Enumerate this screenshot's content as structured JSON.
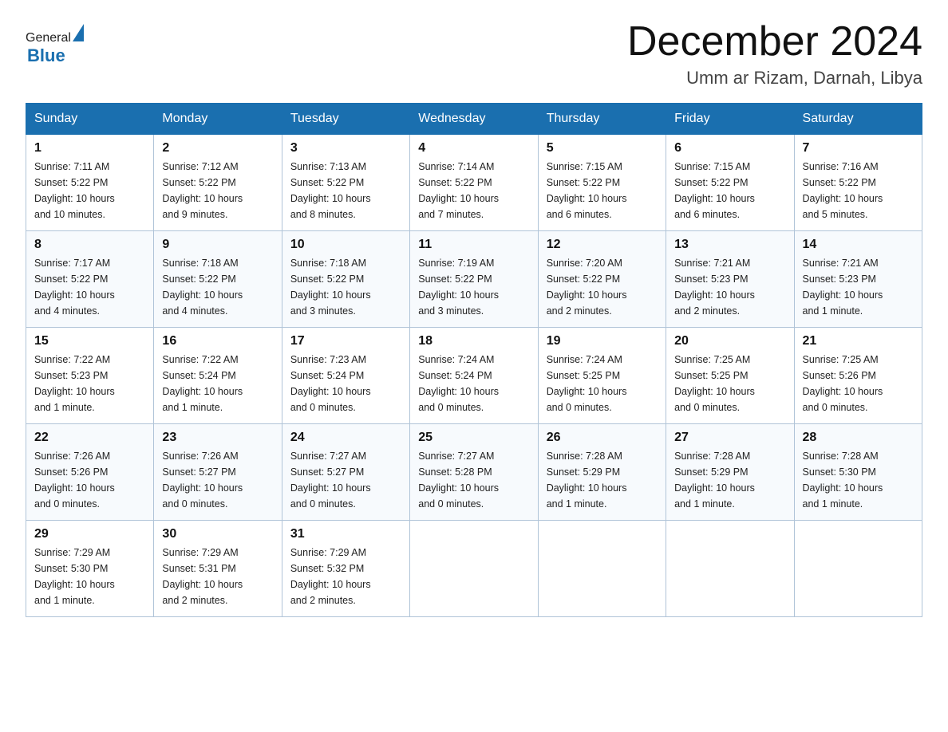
{
  "header": {
    "logo_general": "General",
    "logo_blue": "Blue",
    "month_title": "December 2024",
    "location": "Umm ar Rizam, Darnah, Libya"
  },
  "weekdays": [
    "Sunday",
    "Monday",
    "Tuesday",
    "Wednesday",
    "Thursday",
    "Friday",
    "Saturday"
  ],
  "weeks": [
    [
      {
        "day": 1,
        "sunrise": "7:11 AM",
        "sunset": "5:22 PM",
        "daylight": "10 hours and 10 minutes."
      },
      {
        "day": 2,
        "sunrise": "7:12 AM",
        "sunset": "5:22 PM",
        "daylight": "10 hours and 9 minutes."
      },
      {
        "day": 3,
        "sunrise": "7:13 AM",
        "sunset": "5:22 PM",
        "daylight": "10 hours and 8 minutes."
      },
      {
        "day": 4,
        "sunrise": "7:14 AM",
        "sunset": "5:22 PM",
        "daylight": "10 hours and 7 minutes."
      },
      {
        "day": 5,
        "sunrise": "7:15 AM",
        "sunset": "5:22 PM",
        "daylight": "10 hours and 6 minutes."
      },
      {
        "day": 6,
        "sunrise": "7:15 AM",
        "sunset": "5:22 PM",
        "daylight": "10 hours and 6 minutes."
      },
      {
        "day": 7,
        "sunrise": "7:16 AM",
        "sunset": "5:22 PM",
        "daylight": "10 hours and 5 minutes."
      }
    ],
    [
      {
        "day": 8,
        "sunrise": "7:17 AM",
        "sunset": "5:22 PM",
        "daylight": "10 hours and 4 minutes."
      },
      {
        "day": 9,
        "sunrise": "7:18 AM",
        "sunset": "5:22 PM",
        "daylight": "10 hours and 4 minutes."
      },
      {
        "day": 10,
        "sunrise": "7:18 AM",
        "sunset": "5:22 PM",
        "daylight": "10 hours and 3 minutes."
      },
      {
        "day": 11,
        "sunrise": "7:19 AM",
        "sunset": "5:22 PM",
        "daylight": "10 hours and 3 minutes."
      },
      {
        "day": 12,
        "sunrise": "7:20 AM",
        "sunset": "5:22 PM",
        "daylight": "10 hours and 2 minutes."
      },
      {
        "day": 13,
        "sunrise": "7:21 AM",
        "sunset": "5:23 PM",
        "daylight": "10 hours and 2 minutes."
      },
      {
        "day": 14,
        "sunrise": "7:21 AM",
        "sunset": "5:23 PM",
        "daylight": "10 hours and 1 minute."
      }
    ],
    [
      {
        "day": 15,
        "sunrise": "7:22 AM",
        "sunset": "5:23 PM",
        "daylight": "10 hours and 1 minute."
      },
      {
        "day": 16,
        "sunrise": "7:22 AM",
        "sunset": "5:24 PM",
        "daylight": "10 hours and 1 minute."
      },
      {
        "day": 17,
        "sunrise": "7:23 AM",
        "sunset": "5:24 PM",
        "daylight": "10 hours and 0 minutes."
      },
      {
        "day": 18,
        "sunrise": "7:24 AM",
        "sunset": "5:24 PM",
        "daylight": "10 hours and 0 minutes."
      },
      {
        "day": 19,
        "sunrise": "7:24 AM",
        "sunset": "5:25 PM",
        "daylight": "10 hours and 0 minutes."
      },
      {
        "day": 20,
        "sunrise": "7:25 AM",
        "sunset": "5:25 PM",
        "daylight": "10 hours and 0 minutes."
      },
      {
        "day": 21,
        "sunrise": "7:25 AM",
        "sunset": "5:26 PM",
        "daylight": "10 hours and 0 minutes."
      }
    ],
    [
      {
        "day": 22,
        "sunrise": "7:26 AM",
        "sunset": "5:26 PM",
        "daylight": "10 hours and 0 minutes."
      },
      {
        "day": 23,
        "sunrise": "7:26 AM",
        "sunset": "5:27 PM",
        "daylight": "10 hours and 0 minutes."
      },
      {
        "day": 24,
        "sunrise": "7:27 AM",
        "sunset": "5:27 PM",
        "daylight": "10 hours and 0 minutes."
      },
      {
        "day": 25,
        "sunrise": "7:27 AM",
        "sunset": "5:28 PM",
        "daylight": "10 hours and 0 minutes."
      },
      {
        "day": 26,
        "sunrise": "7:28 AM",
        "sunset": "5:29 PM",
        "daylight": "10 hours and 1 minute."
      },
      {
        "day": 27,
        "sunrise": "7:28 AM",
        "sunset": "5:29 PM",
        "daylight": "10 hours and 1 minute."
      },
      {
        "day": 28,
        "sunrise": "7:28 AM",
        "sunset": "5:30 PM",
        "daylight": "10 hours and 1 minute."
      }
    ],
    [
      {
        "day": 29,
        "sunrise": "7:29 AM",
        "sunset": "5:30 PM",
        "daylight": "10 hours and 1 minute."
      },
      {
        "day": 30,
        "sunrise": "7:29 AM",
        "sunset": "5:31 PM",
        "daylight": "10 hours and 2 minutes."
      },
      {
        "day": 31,
        "sunrise": "7:29 AM",
        "sunset": "5:32 PM",
        "daylight": "10 hours and 2 minutes."
      },
      null,
      null,
      null,
      null
    ]
  ],
  "labels": {
    "sunrise": "Sunrise:",
    "sunset": "Sunset:",
    "daylight": "Daylight:"
  }
}
